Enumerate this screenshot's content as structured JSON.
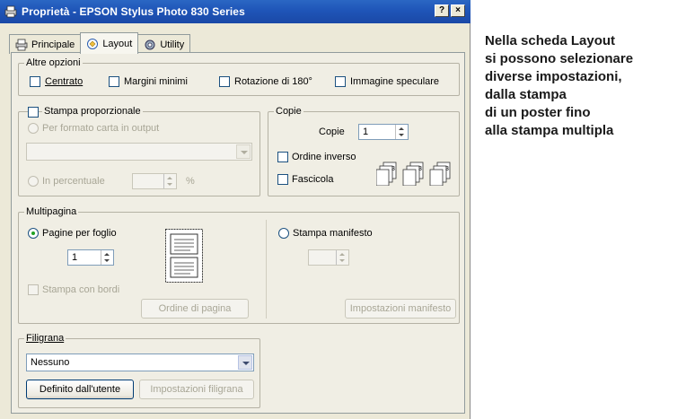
{
  "window": {
    "title": "Proprietà - EPSON Stylus Photo 830 Series",
    "help_button": "?",
    "close_button": "×"
  },
  "tabs": [
    {
      "label": "Principale",
      "icon": "printer-icon"
    },
    {
      "label": "Layout",
      "icon": "layout-icon"
    },
    {
      "label": "Utility",
      "icon": "utility-icon"
    }
  ],
  "altre_opzioni": {
    "legend": "Altre opzioni",
    "centrato": "Centrato",
    "margini_minimi": "Margini minimi",
    "rotazione": "Rotazione di 180°",
    "immagine_speculare": "Immagine speculare"
  },
  "stampa_proporzionale": {
    "legend": "Stampa proporzionale",
    "per_formato": "Per formato carta in output",
    "in_percentuale": "In percentuale",
    "percent_symbol": "%"
  },
  "copie": {
    "legend": "Copie",
    "copie_label": "Copie",
    "copie_value": "1",
    "ordine_inverso": "Ordine inverso",
    "fascicola": "Fascicola"
  },
  "multipagina": {
    "legend": "Multipagina",
    "pagine_per_foglio": "Pagine per foglio",
    "pages_value": "1",
    "stampa_con_bordi": "Stampa con bordi",
    "ordine_di_pagina": "Ordine di pagina",
    "stampa_manifesto": "Stampa manifesto",
    "impostazioni_manifesto": "Impostazioni manifesto"
  },
  "filigrana": {
    "legend": "Filigrana",
    "selected": "Nessuno",
    "definito": "Definito dall'utente",
    "impostazioni_filigrana": "Impostazioni filigrana"
  },
  "caption": {
    "lines": [
      "Nella scheda Layout",
      "si possono selezionare",
      "diverse impostazioni,",
      "dalla stampa",
      "di un poster fino",
      "alla stampa multipla"
    ]
  },
  "colors": {
    "titlebar": "#1f55b8",
    "dialog_bg": "#ece9d8",
    "caption_text": "#1a1a1a"
  }
}
